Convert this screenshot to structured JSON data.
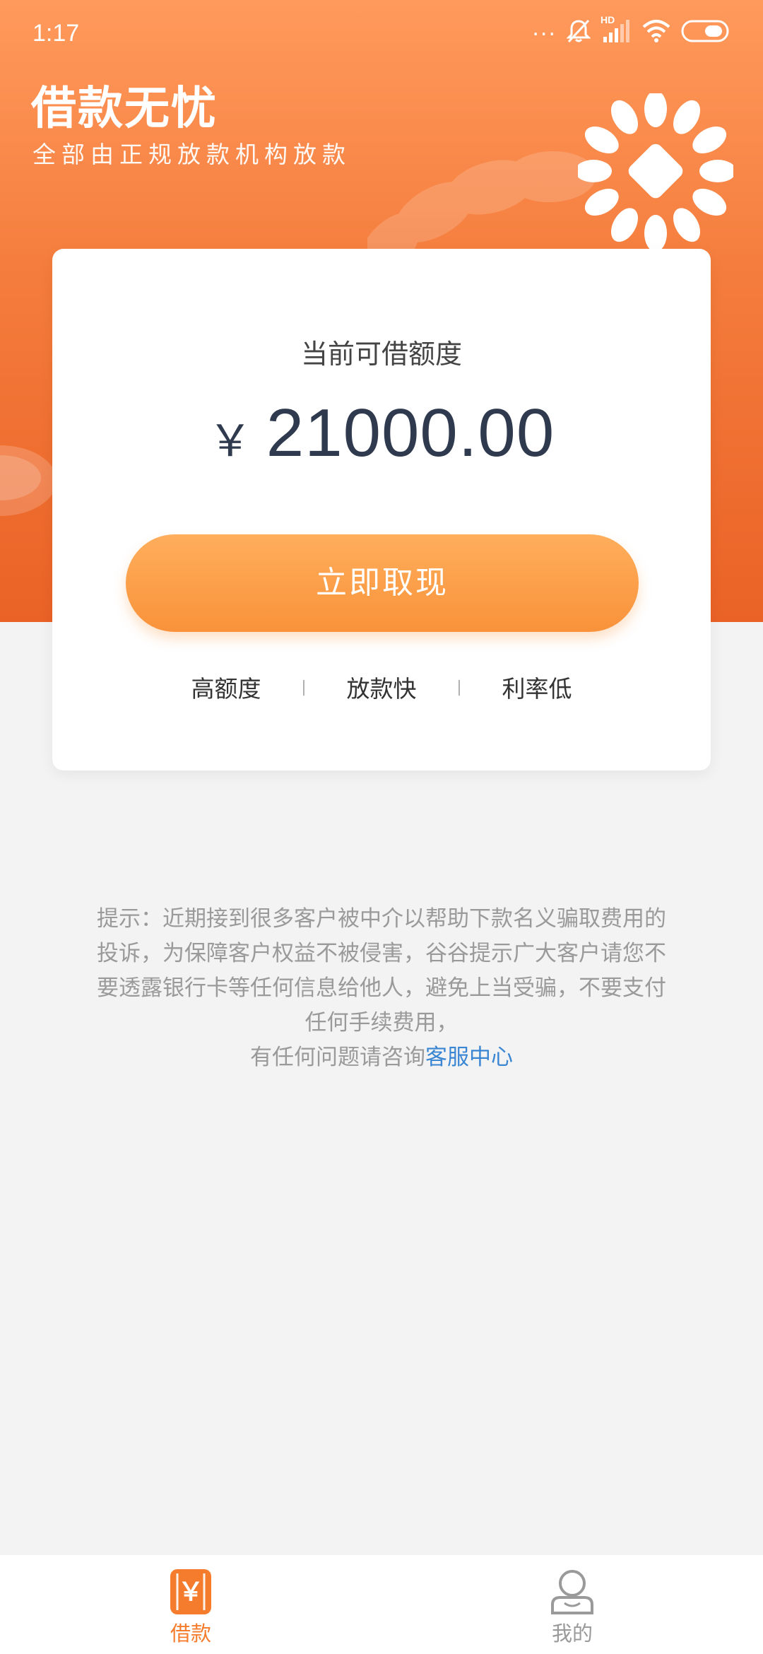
{
  "status_bar": {
    "time": "1:17",
    "more_indicator": "...",
    "network_type": "HD",
    "icons": [
      "more-icon",
      "mute-icon",
      "cellular-signal-icon",
      "wifi-icon",
      "battery-icon"
    ]
  },
  "header": {
    "title": "借款无忧",
    "subtitle": "全部由正规放款机构放款"
  },
  "loan_card": {
    "label": "当前可借额度",
    "currency_symbol": "￥",
    "amount": "21000.00",
    "cta_label": "立即取现",
    "features": [
      "高额度",
      "放款快",
      "利率低"
    ],
    "separator": "|"
  },
  "notice": {
    "line1": "提示：近期接到很多客户被中介以帮助下款名义骗取费用的",
    "line2": "投诉，为保障客户权益不被侵害，谷谷提示广大客户请您不",
    "line3": "要透露银行卡等任何信息给他人，避免上当受骗，不要支付",
    "line4": "任何手续费用，",
    "line5_prefix": "有任何问题请咨询",
    "link_label": "客服中心"
  },
  "bottom_nav": {
    "items": [
      {
        "label": "借款",
        "icon": "yen-icon",
        "glyph": "￥",
        "active": true
      },
      {
        "label": "我的",
        "icon": "user-icon",
        "active": false
      }
    ]
  },
  "colors": {
    "header_top": "#ff9a5c",
    "header_bottom": "#ea6226",
    "cta_top": "#ffae5c",
    "cta_bottom": "#f9923a",
    "amount_text": "#2f3a4e",
    "link": "#3a86d3",
    "nav_active": "#f47c2c",
    "nav_inactive": "#9a9a9a",
    "background": "#f3f3f3"
  }
}
